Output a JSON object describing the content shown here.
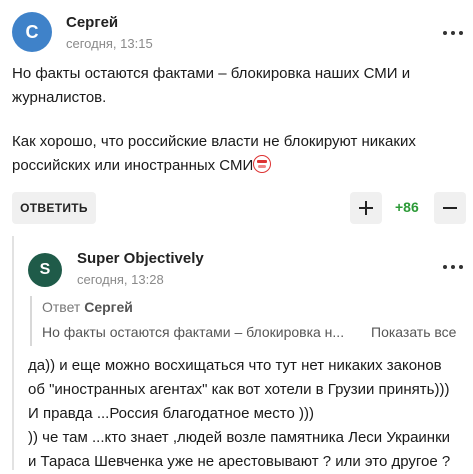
{
  "comment1": {
    "avatar_letter": "С",
    "avatar_color": "#3f82c9",
    "author": "Сергей",
    "time": "сегодня, 13:15",
    "lines": [
      "Но факты остаются фактами – блокировка наших СМИ и",
      "журналистов.",
      "",
      "Как хорошо, что российские власти не блокируют никаких",
      "российских или иностранных СМИ"
    ],
    "emoji_icon": "tongue-out-emoji-icon",
    "reply_label": "ОТВЕТИТЬ",
    "vote_count": "+86",
    "vote_color": "#2c9a37"
  },
  "comment2": {
    "avatar_letter": "S",
    "avatar_color": "#1f5b49",
    "author": "Super Objectively",
    "time": "сегодня, 13:28",
    "quote_prefix": "Ответ",
    "quote_author": "Сергей",
    "quote_text": "Но факты остаются фактами – блокировка н...",
    "show_all": "Показать все",
    "lines": [
      "да)) и еще можно восхищаться что тут нет никаких законов",
      "об \"иностранных агентах\" как вот хотели в Грузии принять)))",
      "И правда ...Россия благодатное место )))",
      ")) че там ...кто знает ,людей возле памятника Леси Украинки",
      "и Тараса Шевченка уже не арестовывают ? или это другое ?"
    ]
  }
}
